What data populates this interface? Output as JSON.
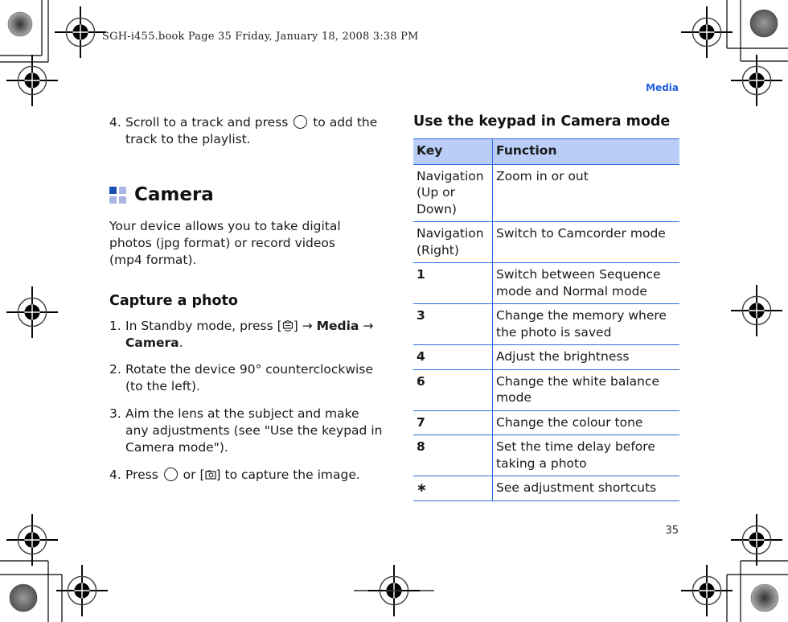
{
  "slug": "SGH-i455.book  Page 35  Friday, January 18, 2008  3:38 PM",
  "section_label": "Media",
  "page_number": "35",
  "colors": {
    "accent": "#1f5fe0",
    "table_header_bg": "#b9cdf7",
    "table_rule": "#2c6be0",
    "icon_dark": "#1e50b4",
    "icon_light": "#aab6e4"
  },
  "left": {
    "prev_step": {
      "num": "4.",
      "text_before": "Scroll to a track and press",
      "key_icon": "ok-key-icon",
      "text_after": "to add the track to the playlist."
    },
    "camera_heading": "Camera",
    "camera_heading_icon": "section-squares-icon",
    "intro": "Your device allows you to take digital photos (jpg format) or record videos (mp4 format).",
    "capture_heading": "Capture a photo",
    "steps": [
      {
        "num": "1.",
        "before": "In Standby mode, press [",
        "icon": "menu-key-icon",
        "after": "] → ",
        "bold1": "Media",
        "arrow": " → ",
        "bold2": "Camera",
        "end": "."
      },
      {
        "num": "2.",
        "text": "Rotate the device 90° counterclockwise (to the left)."
      },
      {
        "num": "3.",
        "text": "Aim the lens at the subject and make any adjustments (see \"Use the keypad in Camera mode\")."
      },
      {
        "num": "4.",
        "before": "Press",
        "icon1": "ok-key-icon",
        "mid": "or [",
        "icon2": "camera-key-icon",
        "after": "] to capture the image."
      }
    ]
  },
  "right": {
    "table_title": "Use the keypad in Camera mode",
    "headers": {
      "key": "Key",
      "function": "Function"
    },
    "rows": [
      {
        "key": "Navigation (Up or Down)",
        "function": "Zoom in or out",
        "bold": false
      },
      {
        "key": "Navigation (Right)",
        "function": "Switch to Camcorder mode",
        "bold": false
      },
      {
        "key": "1",
        "function": "Switch between Sequence mode and Normal mode",
        "bold": true
      },
      {
        "key": "3",
        "function": "Change the memory where the photo is saved",
        "bold": true
      },
      {
        "key": "4",
        "function": "Adjust the brightness",
        "bold": true
      },
      {
        "key": "6",
        "function": "Change the white balance mode",
        "bold": true
      },
      {
        "key": "7",
        "function": "Change the colour tone",
        "bold": true
      },
      {
        "key": "8",
        "function": "Set the time delay before taking a photo",
        "bold": true
      },
      {
        "key": "∗",
        "function": "See adjustment shortcuts",
        "bold": true
      }
    ]
  }
}
